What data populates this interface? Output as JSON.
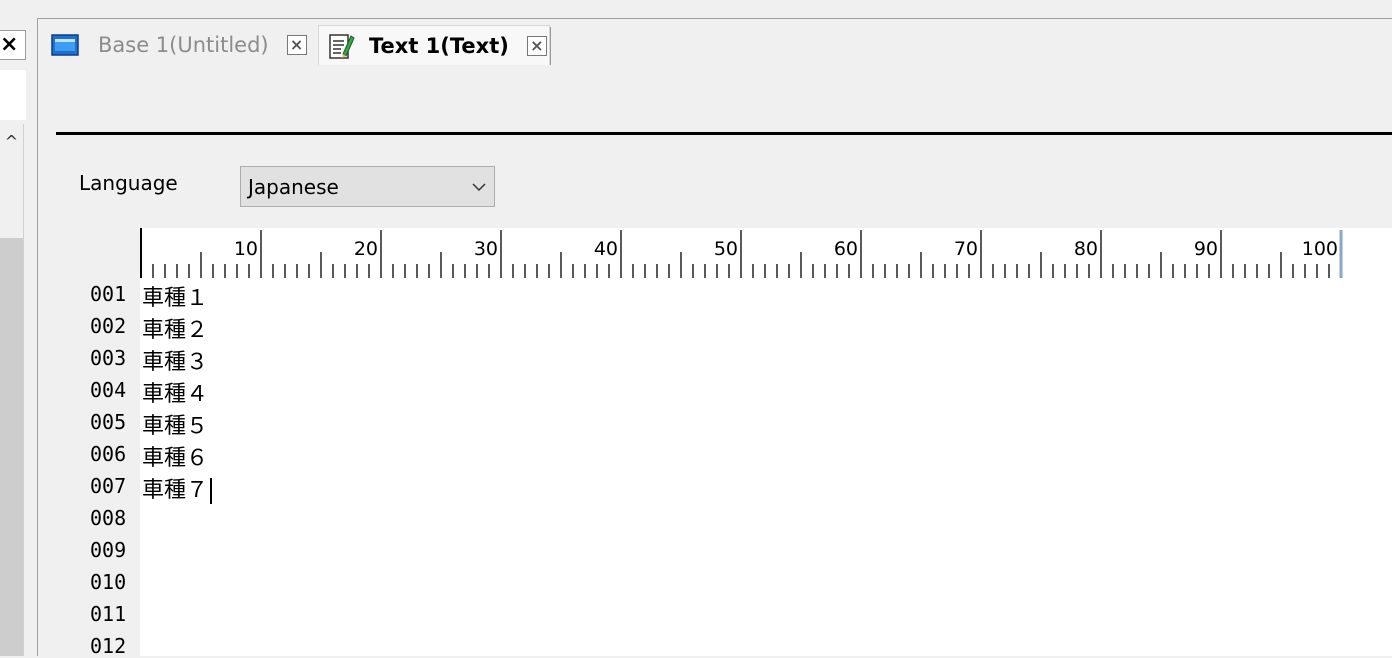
{
  "left_panel": {
    "close_glyph": "×",
    "scroll_up_glyph": "^"
  },
  "tabs": [
    {
      "label": "Base 1(Untitled)",
      "icon": "window-icon",
      "close_glyph": "×",
      "active": false
    },
    {
      "label": "Text 1(Text)",
      "icon": "text-edit-icon",
      "close_glyph": "×",
      "active": true
    }
  ],
  "language": {
    "label": "Language",
    "value": "Japanese"
  },
  "ruler": {
    "labels": [
      "10",
      "20",
      "30",
      "40",
      "50",
      "60",
      "70",
      "80",
      "90",
      "100"
    ]
  },
  "editor": {
    "line_numbers": [
      "001",
      "002",
      "003",
      "004",
      "005",
      "006",
      "007",
      "008",
      "009",
      "010",
      "011",
      "012"
    ],
    "lines": [
      "車種１",
      "車種２",
      "車種３",
      "車種４",
      "車種５",
      "車種６",
      "車種７"
    ]
  },
  "colors": {
    "ruler_marker": "#8aa6c8",
    "tab_icon_blue": "#1e6fd0"
  }
}
